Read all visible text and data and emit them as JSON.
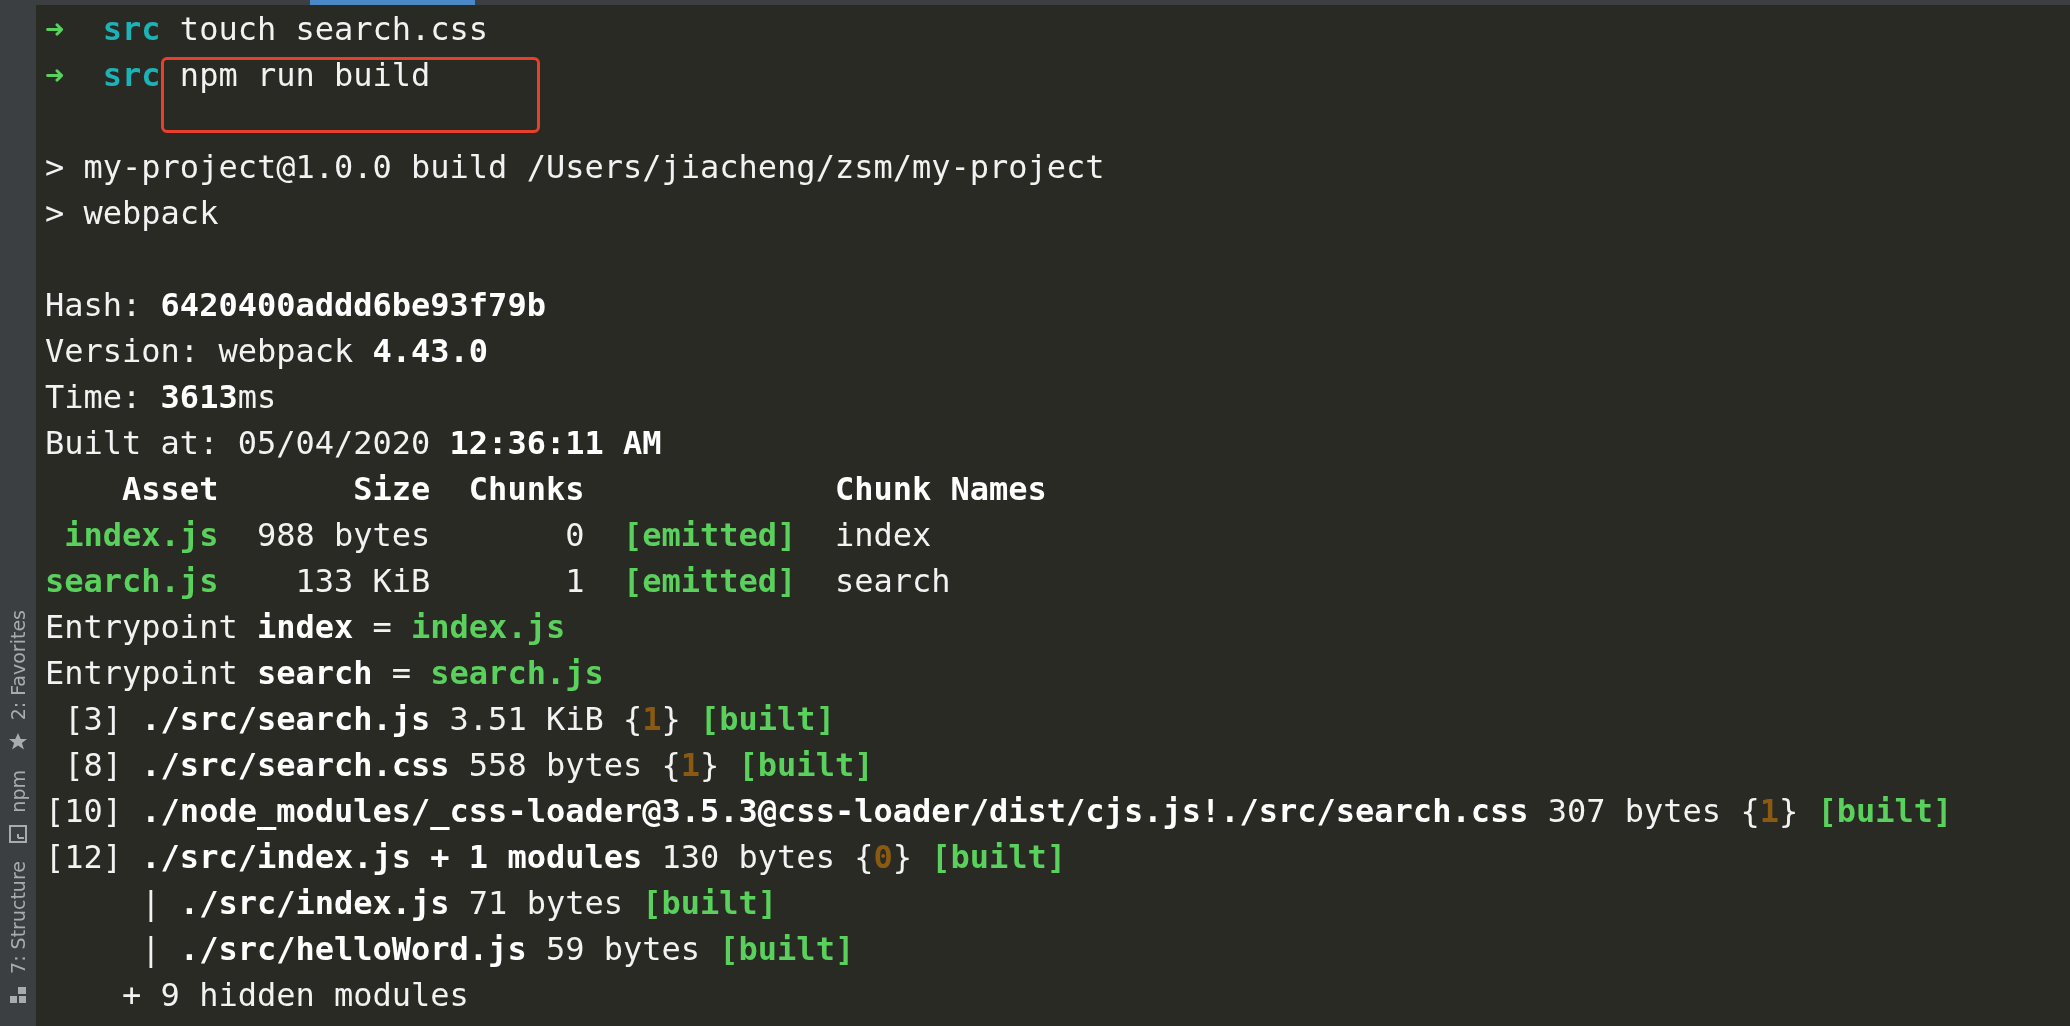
{
  "sidebar": {
    "items": [
      {
        "label": "2: Favorites"
      },
      {
        "label": "npm"
      },
      {
        "label": "7: Structure"
      }
    ]
  },
  "terminal": {
    "lines": [
      {
        "kind": "text",
        "highlighted": false,
        "segments": [
          {
            "kind": "arrow",
            "text": "➜"
          },
          {
            "kind": "cyan",
            "text": "src"
          },
          {
            "kind": "plain",
            "text": " touch search.css"
          }
        ]
      },
      {
        "kind": "text",
        "highlighted": true,
        "segments": [
          {
            "kind": "arrow",
            "text": "➜"
          },
          {
            "kind": "cyan",
            "text": "src"
          },
          {
            "kind": "plain",
            "text": " npm run build"
          }
        ]
      },
      {
        "kind": "blank",
        "highlighted": false
      },
      {
        "kind": "text",
        "highlighted": false,
        "segments": [
          {
            "kind": "plain",
            "text": "> my-project@1.0.0 build /Users/jiacheng/zsm/my-project"
          }
        ]
      },
      {
        "kind": "text",
        "highlighted": false,
        "segments": [
          {
            "kind": "plain",
            "text": "> webpack"
          }
        ]
      },
      {
        "kind": "blank",
        "highlighted": false
      },
      {
        "kind": "text",
        "highlighted": false,
        "segments": [
          {
            "kind": "plain",
            "text": "Hash: "
          },
          {
            "kind": "bold",
            "text": "6420400addd6be93f79b"
          }
        ]
      },
      {
        "kind": "text",
        "highlighted": false,
        "segments": [
          {
            "kind": "plain",
            "text": "Version: webpack "
          },
          {
            "kind": "bold",
            "text": "4.43.0"
          }
        ]
      },
      {
        "kind": "text",
        "highlighted": false,
        "segments": [
          {
            "kind": "plain",
            "text": "Time: "
          },
          {
            "kind": "bold",
            "text": "3613"
          },
          {
            "kind": "plain",
            "text": "ms"
          }
        ]
      },
      {
        "kind": "text",
        "highlighted": false,
        "segments": [
          {
            "kind": "plain",
            "text": "Built at: 05/04/2020 "
          },
          {
            "kind": "bold",
            "text": "12:36:11 AM"
          }
        ]
      },
      {
        "kind": "text",
        "highlighted": false,
        "segments": [
          {
            "kind": "bold",
            "text": "    Asset       Size  Chunks             Chunk Names"
          }
        ]
      },
      {
        "kind": "text",
        "highlighted": false,
        "segments": [
          {
            "kind": "green",
            "text": " index.js"
          },
          {
            "kind": "plain",
            "text": "  988 bytes       0  "
          },
          {
            "kind": "green",
            "text": "[emitted]"
          },
          {
            "kind": "plain",
            "text": "  index"
          }
        ]
      },
      {
        "kind": "text",
        "highlighted": false,
        "segments": [
          {
            "kind": "green",
            "text": "search.js"
          },
          {
            "kind": "plain",
            "text": "    133 KiB       1  "
          },
          {
            "kind": "green",
            "text": "[emitted]"
          },
          {
            "kind": "plain",
            "text": "  search"
          }
        ]
      },
      {
        "kind": "text",
        "highlighted": false,
        "segments": [
          {
            "kind": "plain",
            "text": "Entrypoint "
          },
          {
            "kind": "bold",
            "text": "index"
          },
          {
            "kind": "plain",
            "text": " = "
          },
          {
            "kind": "green",
            "text": "index.js"
          }
        ]
      },
      {
        "kind": "text",
        "highlighted": false,
        "segments": [
          {
            "kind": "plain",
            "text": "Entrypoint "
          },
          {
            "kind": "bold",
            "text": "search"
          },
          {
            "kind": "plain",
            "text": " = "
          },
          {
            "kind": "green",
            "text": "search.js"
          }
        ]
      },
      {
        "kind": "text",
        "highlighted": false,
        "segments": [
          {
            "kind": "plain",
            "text": " [3] "
          },
          {
            "kind": "bold",
            "text": "./src/search.js"
          },
          {
            "kind": "plain",
            "text": " 3.51 KiB {"
          },
          {
            "kind": "brown",
            "text": "1"
          },
          {
            "kind": "plain",
            "text": "} "
          },
          {
            "kind": "green",
            "text": "[built]"
          }
        ]
      },
      {
        "kind": "text",
        "highlighted": false,
        "segments": [
          {
            "kind": "plain",
            "text": " [8] "
          },
          {
            "kind": "bold",
            "text": "./src/search.css"
          },
          {
            "kind": "plain",
            "text": " 558 bytes {"
          },
          {
            "kind": "brown",
            "text": "1"
          },
          {
            "kind": "plain",
            "text": "} "
          },
          {
            "kind": "green",
            "text": "[built]"
          }
        ]
      },
      {
        "kind": "text",
        "highlighted": false,
        "segments": [
          {
            "kind": "plain",
            "text": "[10] "
          },
          {
            "kind": "bold",
            "text": "./node_modules/_css-loader@3.5.3@css-loader/dist/cjs.js!./src/search.css"
          },
          {
            "kind": "plain",
            "text": " 307 bytes {"
          },
          {
            "kind": "brown",
            "text": "1"
          },
          {
            "kind": "plain",
            "text": "} "
          },
          {
            "kind": "green",
            "text": "[built]"
          }
        ]
      },
      {
        "kind": "text",
        "highlighted": false,
        "segments": [
          {
            "kind": "plain",
            "text": "[12] "
          },
          {
            "kind": "bold",
            "text": "./src/index.js + 1 modules"
          },
          {
            "kind": "plain",
            "text": " 130 bytes {"
          },
          {
            "kind": "brown",
            "text": "0"
          },
          {
            "kind": "plain",
            "text": "} "
          },
          {
            "kind": "green",
            "text": "[built]"
          }
        ]
      },
      {
        "kind": "text",
        "highlighted": false,
        "segments": [
          {
            "kind": "plain",
            "text": "     | "
          },
          {
            "kind": "bold",
            "text": "./src/index.js"
          },
          {
            "kind": "plain",
            "text": " 71 bytes "
          },
          {
            "kind": "green",
            "text": "[built]"
          }
        ]
      },
      {
        "kind": "text",
        "highlighted": false,
        "segments": [
          {
            "kind": "plain",
            "text": "     | "
          },
          {
            "kind": "bold",
            "text": "./src/helloWord.js"
          },
          {
            "kind": "plain",
            "text": " 59 bytes "
          },
          {
            "kind": "green",
            "text": "[built]"
          }
        ]
      },
      {
        "kind": "text",
        "highlighted": false,
        "segments": [
          {
            "kind": "plain",
            "text": "    + 9 hidden modules"
          }
        ]
      }
    ]
  }
}
